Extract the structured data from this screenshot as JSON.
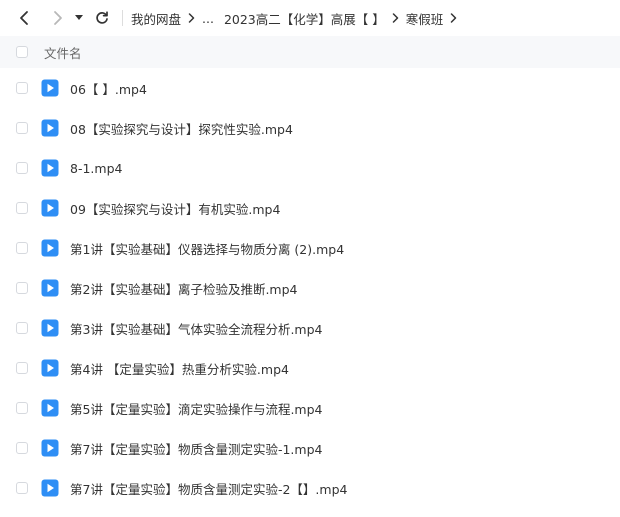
{
  "toolbar": {
    "back_icon": "chevron-left-icon",
    "forward_icon": "chevron-right-icon",
    "history_icon": "caret-down-icon",
    "refresh_icon": "refresh-icon"
  },
  "breadcrumb": {
    "items": [
      "我的网盘",
      "...",
      "2023高二【化学】高展【 】",
      "寒假班"
    ]
  },
  "list_header": {
    "name_label": "文件名"
  },
  "files": [
    {
      "name": "06【 】.mp4",
      "icon": "video-file-icon"
    },
    {
      "name": "08【实验探究与设计】探究性实验.mp4",
      "icon": "video-file-icon"
    },
    {
      "name": "8-1.mp4",
      "icon": "video-file-icon"
    },
    {
      "name": "09【实验探究与设计】有机实验.mp4",
      "icon": "video-file-icon"
    },
    {
      "name": "第1讲【实验基础】仪器选择与物质分离 (2).mp4",
      "icon": "video-file-icon"
    },
    {
      "name": "第2讲【实验基础】离子检验及推断.mp4",
      "icon": "video-file-icon"
    },
    {
      "name": "第3讲【实验基础】气体实验全流程分析.mp4",
      "icon": "video-file-icon"
    },
    {
      "name": "第4讲 【定量实验】热重分析实验.mp4",
      "icon": "video-file-icon"
    },
    {
      "name": "第5讲【定量实验】滴定实验操作与流程.mp4",
      "icon": "video-file-icon"
    },
    {
      "name": "第7讲【定量实验】物质含量测定实验-1.mp4",
      "icon": "video-file-icon"
    },
    {
      "name": "第7讲【定量实验】物质含量测定实验-2【】.mp4",
      "icon": "video-file-icon"
    }
  ],
  "colors": {
    "accent": "#2e8ef5",
    "header_bg": "#f7f8fa",
    "text": "#333333",
    "muted": "#666666"
  }
}
